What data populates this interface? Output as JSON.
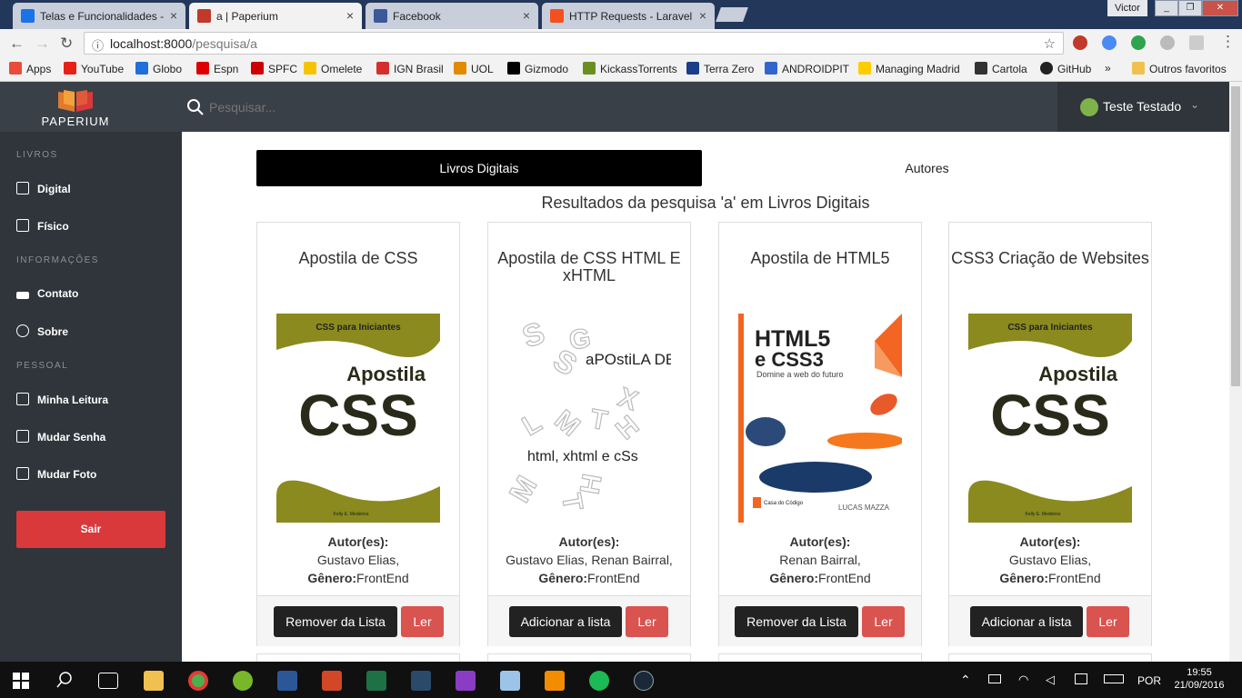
{
  "browser": {
    "tabs": [
      {
        "title": "Telas e Funcionalidades -",
        "color": "#1a73e8"
      },
      {
        "title": "a | Paperium",
        "color": "#c0392b"
      },
      {
        "title": "Facebook",
        "color": "#3b5998"
      },
      {
        "title": "HTTP Requests - Laravel",
        "color": "#f4511e"
      }
    ],
    "close_glyph": "×",
    "profile_name": "Victor",
    "url_host": "localhost:8000",
    "url_path": "/pesquisa/a",
    "bookmarks": [
      {
        "label": "Apps",
        "color": "#e74c3c"
      },
      {
        "label": "YouTube",
        "color": "#e62117"
      },
      {
        "label": "Globo",
        "color": "#1e6fd9"
      },
      {
        "label": "Espn",
        "color": "#d00"
      },
      {
        "label": "SPFC",
        "color": "#c00"
      },
      {
        "label": "Omelete",
        "color": "#f5c400"
      },
      {
        "label": "IGN Brasil",
        "color": "#d32f2f"
      },
      {
        "label": "UOL",
        "color": "#e08b00"
      },
      {
        "label": "Gizmodo",
        "color": "#000"
      },
      {
        "label": "KickassTorrents",
        "color": "#6b8e23"
      },
      {
        "label": "Terra Zero",
        "color": "#1a3e8a"
      },
      {
        "label": "ANDROIDPIT",
        "color": "#3266cc"
      },
      {
        "label": "Managing Madrid",
        "color": "#ffcc00"
      },
      {
        "label": "Cartola",
        "color": "#333"
      },
      {
        "label": "GitHub",
        "color": "#222"
      }
    ],
    "more_glyph": "»",
    "other_bookmarks": "Outros favoritos"
  },
  "app": {
    "logo_text": "PAPERIUM",
    "search_placeholder": "Pesquisar...",
    "user_name": "Teste Testado",
    "sidebar": {
      "sec_livros": "LIVROS",
      "digital": "Digital",
      "fisico": "Físico",
      "sec_info": "INFORMAÇÕES",
      "contato": "Contato",
      "sobre": "Sobre",
      "sec_pessoal": "PESSOAL",
      "minha_leitura": "Minha Leitura",
      "mudar_senha": "Mudar Senha",
      "mudar_foto": "Mudar Foto",
      "sair": "Sair"
    },
    "tabs": {
      "digital": "Livros Digitais",
      "autores": "Autores"
    },
    "results_title": "Resultados da pesquisa 'a' em Livros Digitais",
    "author_label": "Autor(es):",
    "genre_label": "Gênero:",
    "read_label": "Ler",
    "books": [
      {
        "title": "Apostila de CSS",
        "authors": "Gustavo Elias,",
        "genre": "FrontEnd",
        "action": "Remover da Lista",
        "cover": {
          "kind": "css",
          "top_text": "CSS para Iniciantes",
          "mid_text": "Apostila",
          "big_text": "CSS",
          "foot_text": "Kelly E. Medeiros"
        }
      },
      {
        "title": "Apostila de CSS HTML E xHTML",
        "authors": "Gustavo Elias, Renan Bairral,",
        "genre": "FrontEnd",
        "action": "Adicionar a lista",
        "cover": {
          "kind": "handwritten",
          "line1": "aPOstiLA DE",
          "line2": "html, xhtml e cSs"
        }
      },
      {
        "title": "Apostila de HTML5",
        "authors": "Renan Bairral,",
        "genre": "FrontEnd",
        "action": "Remover da Lista",
        "cover": {
          "kind": "html5",
          "line1": "HTML5",
          "line2": "e CSS3",
          "subtitle": "Domine a web do futuro",
          "publisher": "Casa do Código",
          "author": "LUCAS MAZZA"
        }
      },
      {
        "title": "CSS3 Criação de Websites",
        "authors": "Gustavo Elias,",
        "genre": "FrontEnd",
        "action": "Adicionar a lista",
        "cover": {
          "kind": "css",
          "top_text": "CSS para Iniciantes",
          "mid_text": "Apostila",
          "big_text": "CSS",
          "foot_text": "Kelly E. Medeiros"
        }
      }
    ]
  },
  "taskbar": {
    "lang": "POR",
    "time": "19:55",
    "date": "21/09/2016"
  }
}
